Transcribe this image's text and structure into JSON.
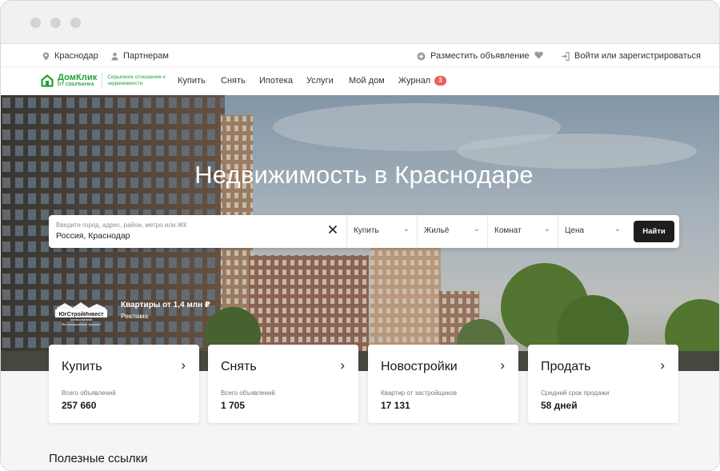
{
  "topbar": {
    "city": "Краснодар",
    "partners": "Партнерам",
    "post_ad": "Разместить объявление",
    "login": "Войти или зарегистрироваться"
  },
  "logo": {
    "name": "ДомКлик",
    "sub": "ОТ СБЕРБАНКА",
    "slogan": "Серьезное отношение к недвижимости"
  },
  "nav": {
    "items": [
      {
        "label": "Купить"
      },
      {
        "label": "Снять"
      },
      {
        "label": "Ипотека"
      },
      {
        "label": "Услуги"
      },
      {
        "label": "Мой дом"
      },
      {
        "label": "Журнал"
      }
    ],
    "journal_badge": "3"
  },
  "hero": {
    "title": "Недвижимость в Краснодаре"
  },
  "search": {
    "hint": "Введите город, адрес, район, метро или ЖК",
    "value": "Россия, Краснодар",
    "deal": "Купить",
    "type": "Жильё",
    "rooms": "Комнат",
    "price": "Цена",
    "button": "Найти"
  },
  "ad": {
    "brand": "ЮгСтройИнвест",
    "brand_sub": "группа компаний",
    "brand_tag": "Нас рекомендуют друзьям!",
    "title": "Квартиры от 1,4 млн ₽",
    "label": "Реклама"
  },
  "cards": [
    {
      "title": "Купить",
      "label": "Всего объявлений",
      "value": "257 660"
    },
    {
      "title": "Снять",
      "label": "Всего объявлений",
      "value": "1 705"
    },
    {
      "title": "Новостройки",
      "label": "Квартир от застройщиков",
      "value": "17 131"
    },
    {
      "title": "Продать",
      "label": "Средний срок продажи",
      "value": "58 дней"
    }
  ],
  "useful_links": {
    "title": "Полезные ссылки"
  },
  "colors": {
    "brand_green": "#21a038",
    "badge_red": "#ef5b5b",
    "button_dark": "#1e1e1e"
  },
  "icons": {
    "city": "location-pin-icon",
    "partners": "person-icon",
    "post_ad": "plus-circle-icon",
    "favorites": "heart-icon",
    "login": "login-icon",
    "clear": "close-icon",
    "chevron": "chevron-down-icon",
    "arrow": "chevron-right-icon"
  }
}
